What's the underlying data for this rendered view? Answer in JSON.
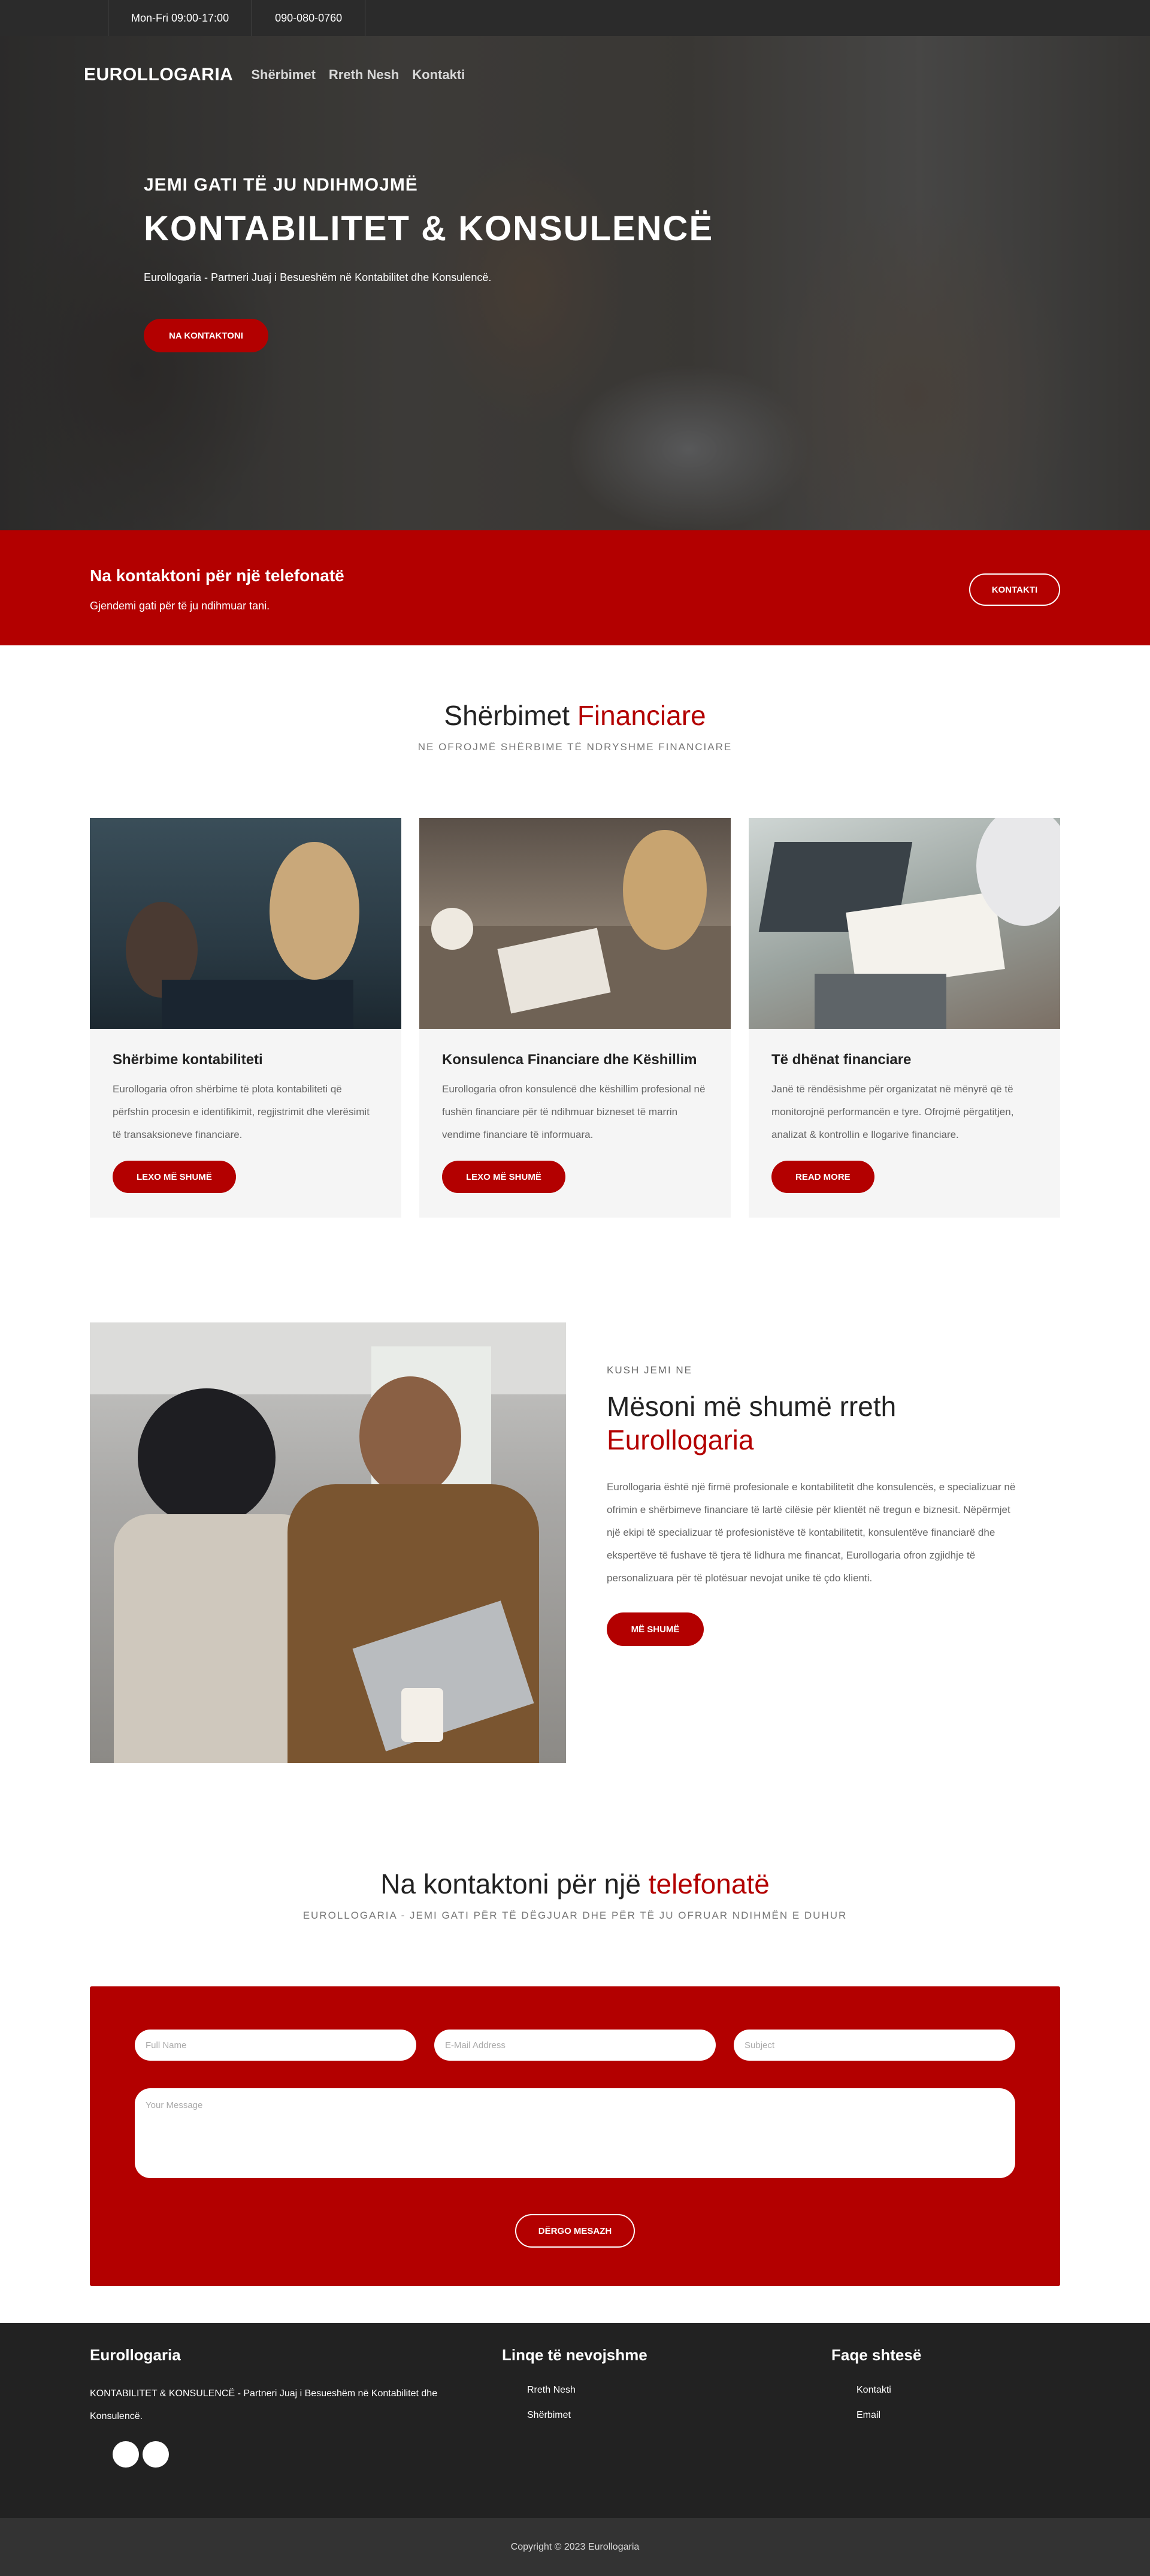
{
  "topbar": {
    "hours": "Mon-Fri 09:00-17:00",
    "phone": "090-080-0760"
  },
  "nav": {
    "logo": "EUROLLOGARIA",
    "items": [
      {
        "label": "Shërbimet"
      },
      {
        "label": "Rreth Nesh"
      },
      {
        "label": "Kontakti"
      }
    ]
  },
  "hero": {
    "kicker": "JEMI GATI TË JU NDIHMOJMË",
    "title": "KONTABILITET & KONSULENCË",
    "subtitle": "Eurollogaria - Partneri Juaj i Besueshëm në Kontabilitet dhe Konsulencë.",
    "button": "NA KONTAKTONI"
  },
  "cta": {
    "title": "Na kontaktoni për një telefonatë",
    "text": "Gjendemi gati për të ju ndihmuar tani.",
    "button": "KONTAKTI"
  },
  "services": {
    "title_plain": "Shërbimet",
    "title_accent": "Financiare",
    "subtitle": "NE OFROJMË SHËRBIME TË NDRYSHME FINANCIARE",
    "cards": [
      {
        "title": "Shërbime kontabiliteti",
        "text": "Eurollogaria ofron shërbime të plota kontabiliteti që përfshin procesin e identifikimit, regjistrimit dhe vlerësimit të transaksioneve financiare.",
        "button": "LEXO MË SHUMË"
      },
      {
        "title": "Konsulenca Financiare dhe Këshillim",
        "text": "Eurollogaria ofron konsulencë dhe këshillim profesional në fushën financiare për të ndihmuar bizneset të marrin vendime financiare të informuara.",
        "button": "LEXO MË SHUMË"
      },
      {
        "title": "Të dhënat financiare",
        "text": "Janë të rëndësishme për organizatat në mënyrë që të monitorojnë performancën e tyre. Ofrojmë përgatitjen, analizat & kontrollin e llogarive financiare.",
        "button": "READ MORE"
      }
    ]
  },
  "about": {
    "kicker": "KUSH JEMI NE",
    "title_plain": "Mësoni më shumë rreth",
    "title_accent": "Eurollogaria",
    "text": "Eurollogaria është një firmë profesionale e kontabilitetit dhe konsulencës, e specializuar në ofrimin e shërbimeve financiare të lartë cilësie për klientët në tregun e biznesit. Nëpërmjet një ekipi të specializuar të profesionistëve të kontabilitetit, konsulentëve financiarë dhe ekspertëve të fushave të tjera të lidhura me financat, Eurollogaria ofron zgjidhje të personalizuara për të plotësuar nevojat unike të çdo klienti.",
    "button": "MË SHUMË"
  },
  "contact": {
    "title_plain": "Na kontaktoni për një",
    "title_accent": "telefonatë",
    "subtitle": "EUROLLOGARIA - JEMI GATI PËR TË DËGJUAR DHE PËR TË JU OFRUAR NDIHMËN E DUHUR",
    "fields": {
      "name_placeholder": "Full Name",
      "email_placeholder": "E-Mail Address",
      "subject_placeholder": "Subject",
      "message_placeholder": "Your Message"
    },
    "button": "DËRGO MESAZH"
  },
  "footer": {
    "brand_title": "Eurollogaria",
    "brand_text": "KONTABILITET & KONSULENCË - Partneri Juaj i Besueshëm në Kontabilitet dhe Konsulencë.",
    "links_title": "Linqe të nevojshme",
    "links": [
      {
        "label": "Rreth Nesh"
      },
      {
        "label": "Shërbimet"
      }
    ],
    "pages_title": "Faqe shtesë",
    "pages": [
      {
        "label": "Kontakti"
      },
      {
        "label": "Email"
      }
    ],
    "copyright": "Copyright © 2023 Eurollogaria"
  },
  "colors": {
    "accent": "#b30000",
    "dark": "#222222",
    "topbar": "#2b2b2b"
  }
}
